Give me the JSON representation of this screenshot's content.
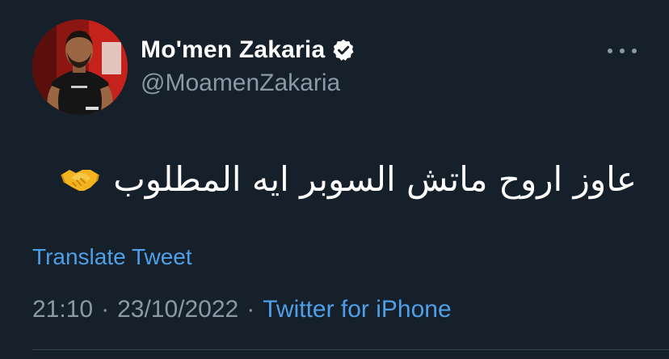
{
  "tweet": {
    "author": {
      "display_name": "Mo'men Zakaria",
      "handle": "@MoamenZakaria",
      "verified": true,
      "avatar_icon": "profile-photo"
    },
    "text": "عاوز اروح ماتش السوبر  ايه المطلوب",
    "emoji": "handshake",
    "translate_label": "Translate Tweet",
    "time": "21:10",
    "date": "23/10/2022",
    "separator": "·",
    "source": "Twitter for iPhone",
    "more_icon": "more-icon"
  },
  "colors": {
    "background": "#15202b",
    "text_primary": "#ffffff",
    "text_secondary": "#8b98a5",
    "link": "#4f9fe8",
    "divider": "#38444d"
  }
}
